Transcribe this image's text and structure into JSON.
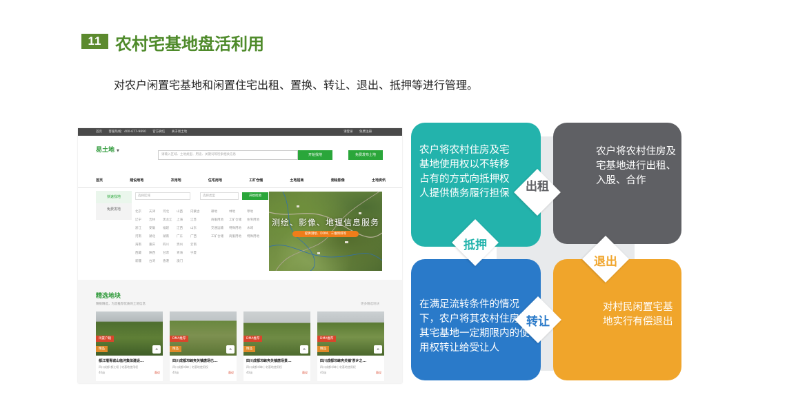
{
  "section": {
    "number": "11",
    "title": "农村宅基地盘活利用"
  },
  "intro": "对农户闲置宅基地和闲置住宅出租、置换、转让、退出、抵押等进行管理。",
  "site": {
    "topbar_items": [
      "首页",
      "客服热线：400-677-9890",
      "官方微信",
      "关于易土地"
    ],
    "topbar_right": [
      "请登录",
      "免费注册"
    ],
    "logo": "易土地",
    "search_placeholder": "请输入区域、土地类型、用途、关键词等检索相关信息",
    "search_button": "开始找地",
    "publish_button": "免费发布土地",
    "nav": [
      "首页",
      "建设用地",
      "农用地",
      "住宅用地",
      "工矿仓储",
      "土地招商",
      "测绘影像",
      "土地资讯"
    ],
    "left_menu": [
      "快速找地",
      "免费发地"
    ],
    "filter_region": "选择区域",
    "filter_type": "选择类型",
    "filter_button": "开始找地",
    "regions": [
      "北京",
      "天津",
      "河北",
      "山西",
      "内蒙古",
      "辽宁",
      "吉林",
      "黑龙江",
      "上海",
      "江苏",
      "浙江",
      "安徽",
      "福建",
      "江西",
      "山东",
      "河南",
      "湖北",
      "湖南",
      "广东",
      "广西",
      "海南",
      "重庆",
      "四川",
      "贵州",
      "云南",
      "西藏",
      "陕西",
      "甘肃",
      "青海",
      "宁夏",
      "新疆",
      "台湾",
      "香港",
      "澳门"
    ],
    "categories": [
      "耕地",
      "林地",
      "草地",
      "商服用地",
      "工矿仓储",
      "住宅用地",
      "交通运输",
      "特殊用地",
      "水域",
      "工矿仓储",
      "商服用地",
      "特殊用地"
    ],
    "banner_text": "测绘、影像、地理信息服务",
    "banner_sub": "提供测绘、DOM、三维倾斜等",
    "featured_title": "精选地块",
    "featured_sub": "精挑精选，为您推荐优质的土地信息",
    "featured_more": "更多精选地块",
    "cards": [
      {
        "tag": "闲置户籍",
        "tag2": "精品",
        "title": "都江堰青城山临河集体建设...",
        "sub": "四川成都 都江堰 | 宅基地使用权",
        "area": "40亩",
        "price": "面议"
      },
      {
        "tag": "DMA推荐",
        "tag2": "精品",
        "title": "四川成都邛崃夹关镇唐场已...",
        "sub": "四川成都邛崃 | 宅基地使用权",
        "area": "40亩",
        "price": "面议"
      },
      {
        "tag": "DMA推荐",
        "tag2": "精品",
        "title": "四川成都邛崃夹关镇唐场景...",
        "sub": "四川成都邛崃 | 宅基地使用权",
        "area": "40亩",
        "price": "面议"
      },
      {
        "tag": "DMA推荐",
        "tag2": "精品",
        "title": "四川成都邛崃夹关镇'茶乡之...",
        "sub": "四川成都邛崃 | 宅基地使用权",
        "area": "40亩",
        "price": "面议"
      }
    ]
  },
  "info": {
    "q1_text": "农户将农村住房及宅基地使用权以不转移占有的方式向抵押权人提供债务履行担保",
    "q2_text": "农户将农村住房及宅基地进行出租、入股、合作",
    "q3_text": "在满足流转条件的情况下，农户将其农村住房及其宅基地一定期限内的使用权转让给受让人",
    "q4_text": "对村民闲置宅基地实行有偿退出",
    "labels": {
      "rent": "出租",
      "mortgage": "抵押",
      "exit": "退出",
      "transfer": "转让"
    },
    "colors": {
      "teal": "#23b3ac",
      "gray": "#5f6064",
      "blue": "#2a7ac9",
      "orange": "#f0a52b"
    }
  }
}
